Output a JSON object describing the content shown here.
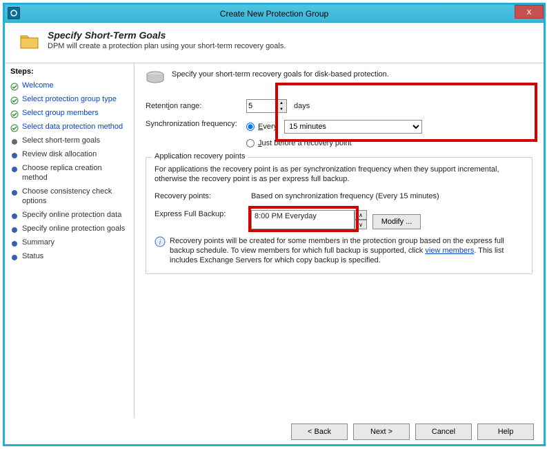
{
  "window": {
    "title": "Create New Protection Group",
    "close": "x"
  },
  "header": {
    "title": "Specify Short-Term Goals",
    "subtitle": "DPM will create a protection plan using your short-term recovery goals."
  },
  "stepsTitle": "Steps:",
  "steps": [
    {
      "label": "Welcome",
      "state": "done"
    },
    {
      "label": "Select protection group type",
      "state": "done"
    },
    {
      "label": "Select group members",
      "state": "done"
    },
    {
      "label": "Select data protection method",
      "state": "done"
    },
    {
      "label": "Select short-term goals",
      "state": "current"
    },
    {
      "label": "Review disk allocation",
      "state": "pending"
    },
    {
      "label": "Choose replica creation method",
      "state": "pending"
    },
    {
      "label": "Choose consistency check options",
      "state": "pending"
    },
    {
      "label": "Specify online protection data",
      "state": "pending"
    },
    {
      "label": "Specify online protection goals",
      "state": "pending"
    },
    {
      "label": "Summary",
      "state": "pending"
    },
    {
      "label": "Status",
      "state": "pending"
    }
  ],
  "content": {
    "intro": "Specify your short-term recovery goals for disk-based protection.",
    "retentionLabelPrefix": "Retent",
    "retentionLabelU": "i",
    "retentionLabelSuffix": "on range:",
    "retentionValue": "5",
    "retentionUnit": "days",
    "syncLabel": "Synchronization frequency:",
    "everyPrefix": "",
    "everyU": "E",
    "everySuffix": "very",
    "syncValue": "15 minutes",
    "justBeforePrefix": "",
    "justBeforeU": "J",
    "justBeforeSuffix": "ust before a recovery point",
    "group": {
      "legend": "Application recovery points",
      "desc": "For applications the recovery point is as per synchronization frequency when they support incremental, otherwise the recovery point is as per express full backup.",
      "recPtsLabel": "Recovery points:",
      "recPtsValue": "Based on synchronization frequency (Every 15 minutes)",
      "efbLabel": "Express Full Backup:",
      "efbValue": "8:00 PM Everyday",
      "modify": "Modify ...",
      "infoPrefix": "Recovery points will be created for some members in the protection group based on the express full backup schedule. To view members for which full backup is supported, click ",
      "infoLink": "view members",
      "infoSuffix": ". This list includes Exchange Servers for which copy backup is specified."
    }
  },
  "footer": {
    "back": "< Back",
    "next": "Next >",
    "cancel": "Cancel",
    "help": "Help"
  }
}
